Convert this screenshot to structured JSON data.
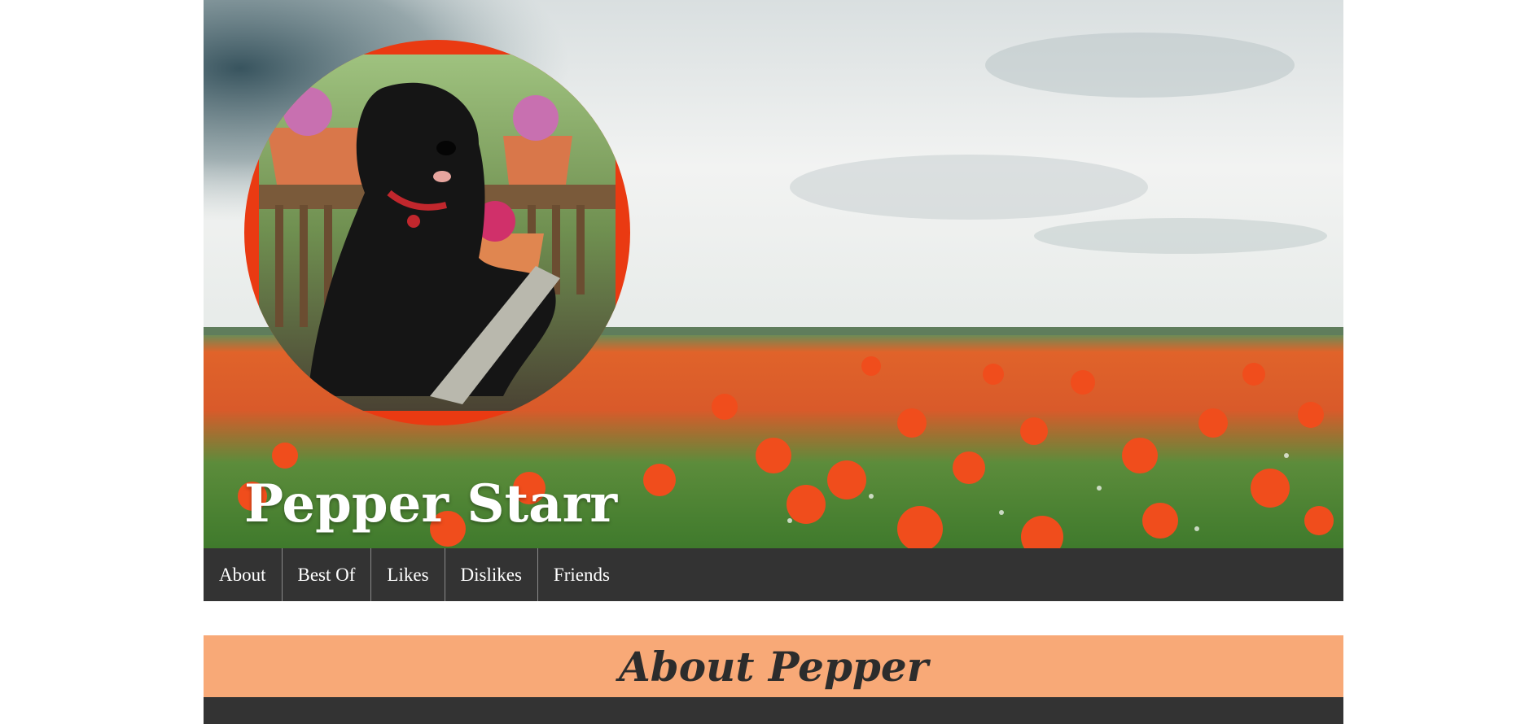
{
  "site": {
    "title": "Pepper Starr"
  },
  "nav": {
    "items": [
      {
        "label": "About"
      },
      {
        "label": "Best Of"
      },
      {
        "label": "Likes"
      },
      {
        "label": "Dislikes"
      },
      {
        "label": "Friends"
      }
    ]
  },
  "section": {
    "heading": "About Pepper"
  },
  "colors": {
    "nav_background": "#333333",
    "section_heading_background": "#f8a977",
    "avatar_ring": "#ea3a12",
    "heading_text": "#2c2c2c"
  },
  "images": {
    "hero": "poppy-field-cloudy-sky",
    "avatar": "black-curly-dog-on-deck-with-flower-pots"
  }
}
